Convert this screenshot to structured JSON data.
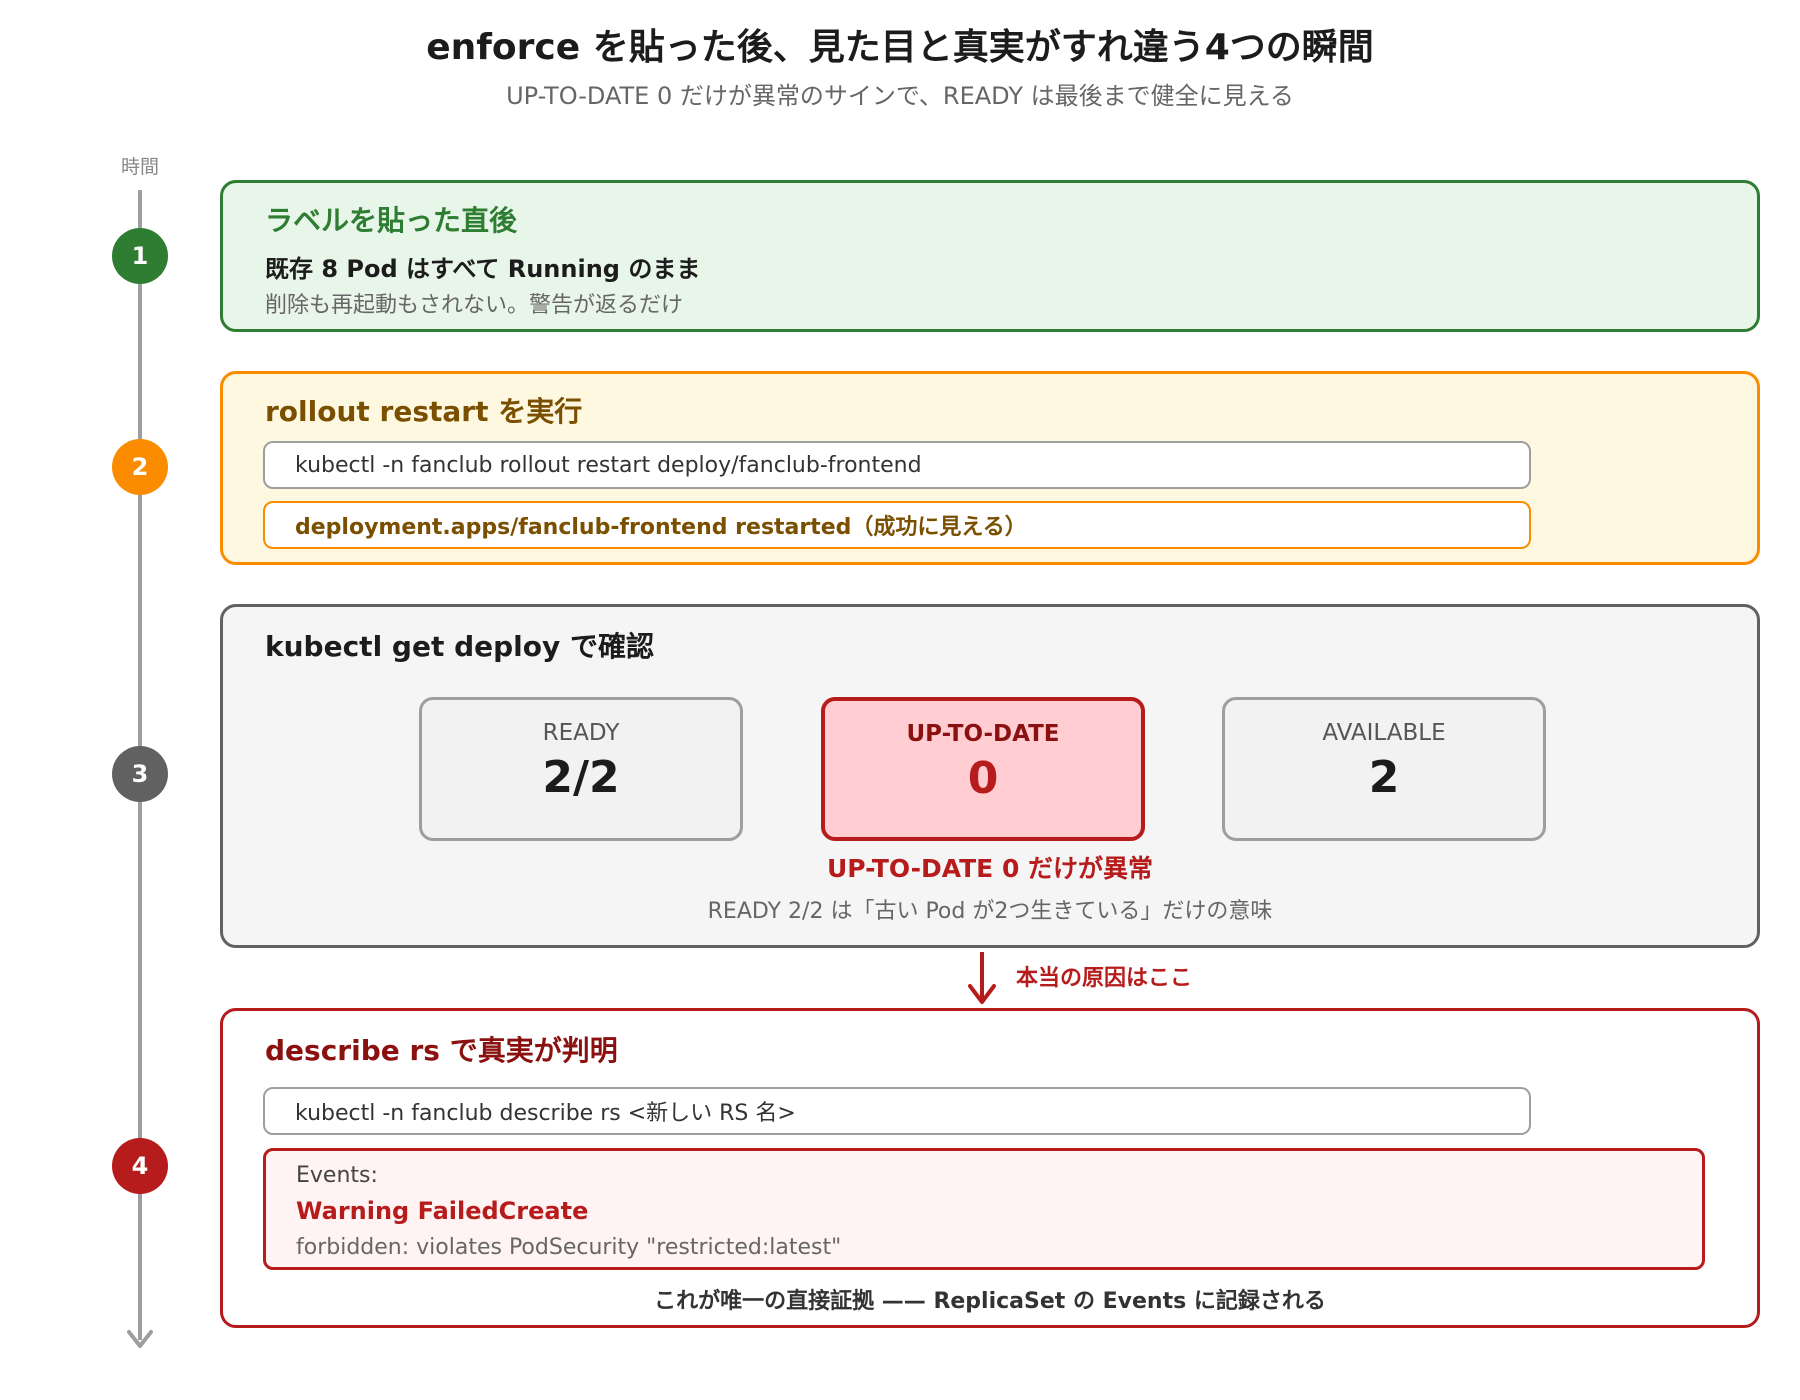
{
  "title": "enforce を貼った後、見た目と真実がすれ違う4つの瞬間",
  "subtitle": "UP-TO-DATE 0 だけが異常のサインで、READY は最後まで健全に見える",
  "timeline": {
    "label": "時間"
  },
  "colors": {
    "green": "#2e7d32",
    "orange": "#fb8c00",
    "gray": "#616161",
    "red": "#b71c1c"
  },
  "steps": [
    {
      "number": "1",
      "heading": "ラベルを貼った直後",
      "line1": "既存 8 Pod はすべて Running のまま",
      "line2": "削除も再起動もされない。警告が返るだけ"
    },
    {
      "number": "2",
      "heading": "rollout restart を実行",
      "command": "kubectl -n fanclub rollout restart deploy/fanclub-frontend",
      "result": "deployment.apps/fanclub-frontend restarted（成功に見える）"
    },
    {
      "number": "3",
      "heading": "kubectl get deploy で確認",
      "metrics": [
        {
          "label": "READY",
          "value": "2/2"
        },
        {
          "label": "UP-TO-DATE",
          "value": "0"
        },
        {
          "label": "AVAILABLE",
          "value": "2"
        }
      ],
      "alert": "UP-TO-DATE 0 だけが異常",
      "note": "READY 2/2 は「古い Pod が2つ生きている」だけの意味"
    },
    {
      "number": "4",
      "heading": "describe rs で真実が判明",
      "command": "kubectl -n fanclub describe rs <新しい RS 名>",
      "events_label": "Events:",
      "warning": "Warning FailedCreate",
      "detail": "forbidden: violates PodSecurity \"restricted:latest\"",
      "footer": "これが唯一の直接証拠 —— ReplicaSet の Events に記録される"
    }
  ],
  "connector": {
    "label": "本当の原因はここ"
  }
}
